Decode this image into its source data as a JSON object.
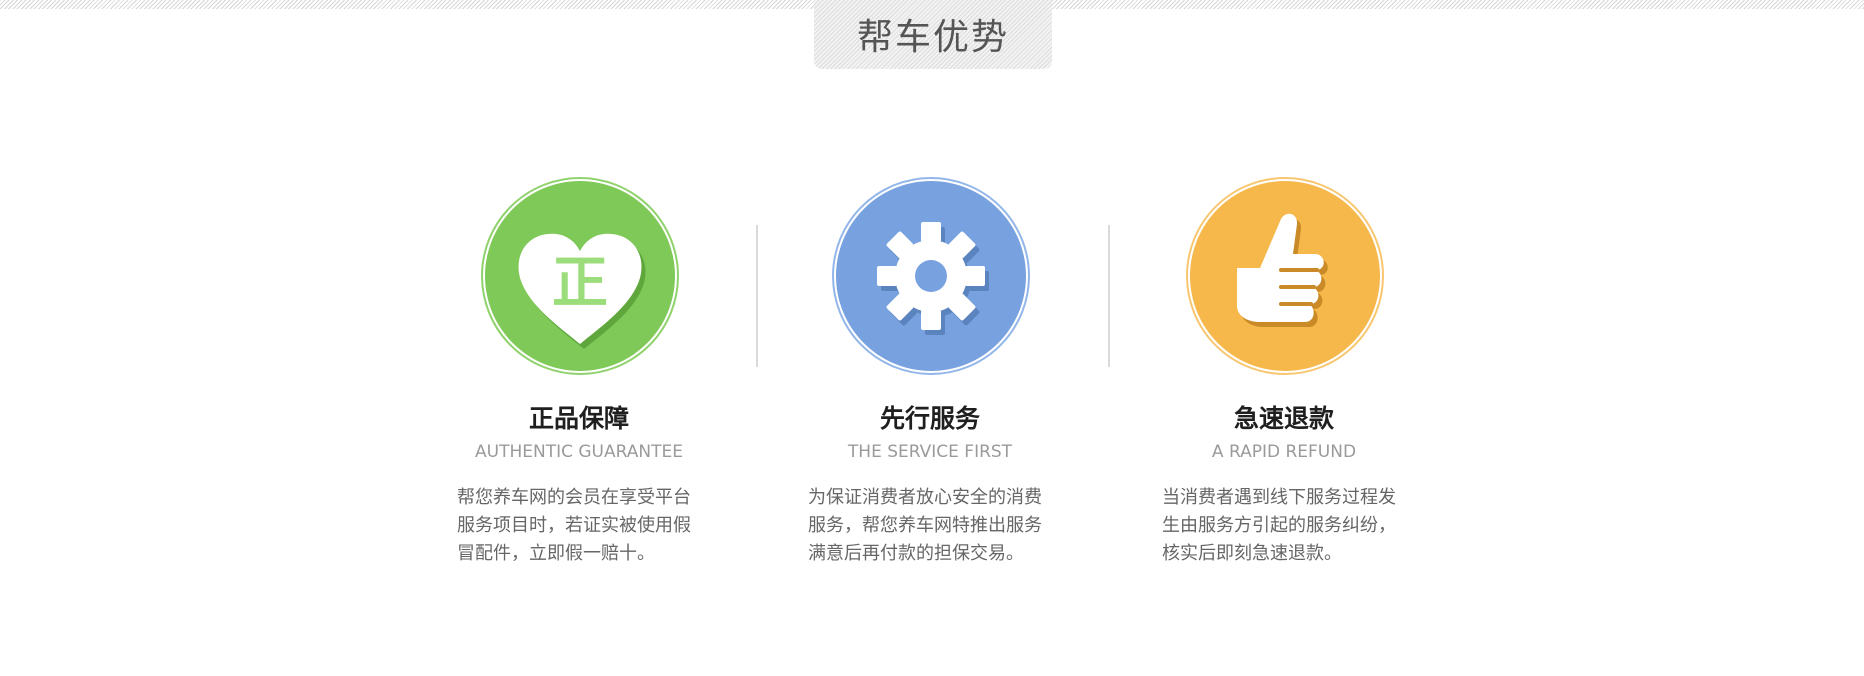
{
  "section": {
    "title": "帮车优势"
  },
  "features": [
    {
      "title": "正品保障",
      "subtitle": "AUTHENTIC GUARANTEE",
      "description": "帮您养车网的会员在享受平台服务项目时，若证实被使用假冒配件，立即假一赔十。",
      "icon": "heart-icon",
      "icon_text": "正",
      "color": "#7ec957"
    },
    {
      "title": "先行服务",
      "subtitle": "THE SERVICE FIRST",
      "description": "为保证消费者放心安全的消费服务，帮您养车网特推出服务满意后再付款的担保交易。",
      "icon": "gear-icon",
      "color": "#78a2df"
    },
    {
      "title": "急速退款",
      "subtitle": "A RAPID REFUND",
      "description": "当消费者遇到线下服务过程发生由服务方引起的服务纠纷，核实后即刻急速退款。",
      "icon": "thumbs-up-icon",
      "color": "#f6b84b"
    }
  ]
}
